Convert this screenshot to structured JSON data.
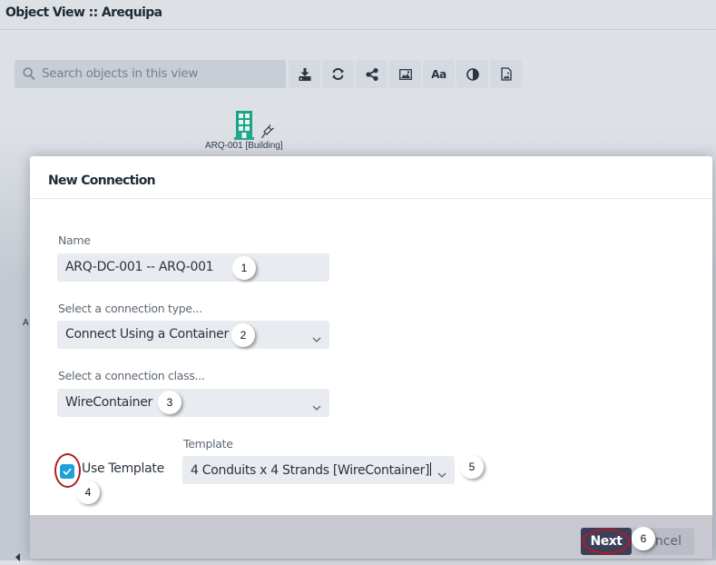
{
  "window": {
    "title": "Object View :: Arequipa"
  },
  "toolbar": {
    "search_placeholder": "Search objects in this view",
    "buttons": [
      {
        "name": "download-icon",
        "label": ""
      },
      {
        "name": "refresh-icon",
        "label": ""
      },
      {
        "name": "share-icon",
        "label": ""
      },
      {
        "name": "image-icon",
        "label": ""
      },
      {
        "name": "font-icon",
        "label": "Aa"
      },
      {
        "name": "contrast-icon",
        "label": ""
      },
      {
        "name": "document-image-icon",
        "label": ""
      }
    ]
  },
  "canvas": {
    "node_label": "ARQ-001 [Building]",
    "node_icon": "building-icon",
    "node_secondary_icon": "plug-icon",
    "partial_label": "A",
    "accent_color": "#1aa486"
  },
  "dialog": {
    "title": "New Connection",
    "fields": {
      "name": {
        "label": "Name",
        "value": "ARQ-DC-001 -- ARQ-001"
      },
      "connection_type": {
        "label": "Select a connection type...",
        "value": "Connect Using a Container"
      },
      "connection_class": {
        "label": "Select a connection class...",
        "value": "WireContainer"
      },
      "use_template": {
        "label": "Use Template",
        "checked": true
      },
      "template": {
        "label": "Template",
        "value": "4 Conduits x 4 Strands [WireContainer]"
      }
    },
    "buttons": {
      "next": "Next",
      "cancel": "Cancel",
      "cancel_visible": "ncel"
    }
  },
  "annotations": {
    "badges": [
      "1",
      "2",
      "3",
      "4",
      "5",
      "6"
    ],
    "highlight_color": "#b01c24"
  }
}
